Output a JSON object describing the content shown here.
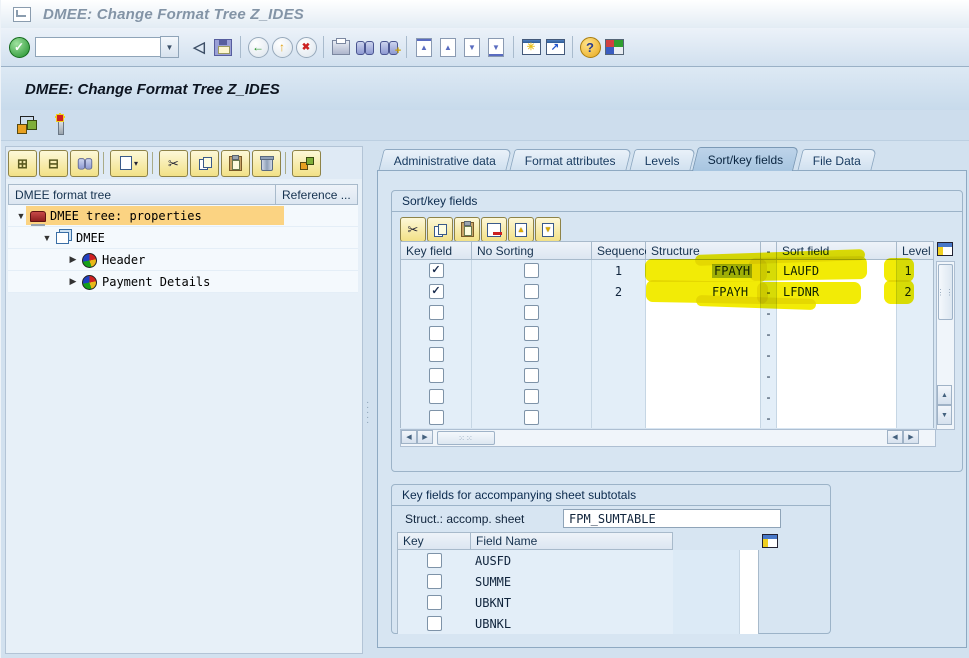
{
  "window": {
    "title": "DMEE: Change Format Tree Z_IDES"
  },
  "toolbar": {
    "command_value": "",
    "icons": [
      "enter-icon",
      "command-field",
      "enter-left-icon",
      "save-icon",
      "back-icon",
      "exit-icon",
      "cancel-icon",
      "print-icon",
      "find-icon",
      "find-next-icon",
      "first-page-icon",
      "page-up-icon",
      "page-down-icon",
      "last-page-icon",
      "new-session-icon",
      "create-shortcut-icon",
      "help-icon",
      "customize-layout-icon"
    ]
  },
  "glyphs": {
    "check": "✓",
    "enter_left": "◁",
    "back": "←",
    "exit": "↑",
    "cancel": "✖",
    "drop": "▼",
    "up": "▲",
    "down": "▼",
    "left": "◀",
    "right": "▶",
    "star": "✳",
    "shortcut": "↗",
    "help": "?",
    "scissors": "✂",
    "expand": "⊞",
    "collapse": "⊟",
    "plus": "+",
    "caret": "▾",
    "tree_open": "▼",
    "tree_closed": "▶",
    "grip_v": "⋮⋮",
    "dots": "·····"
  },
  "screen": {
    "title": "DMEE: Change Format Tree Z_IDES"
  },
  "appbar": {
    "icons": [
      "display-change-icon",
      "activate-icon"
    ]
  },
  "left_panel": {
    "toolbar_icons": [
      "expand-all-icon",
      "collapse-all-icon",
      "find-icon",
      "create-node-icon",
      "cut-icon",
      "copy-icon",
      "paste-icon",
      "delete-icon",
      "swap-icon"
    ],
    "header": {
      "col1": "DMEE format tree",
      "col2": "Reference ..."
    },
    "tree": [
      {
        "label": "DMEE tree: properties",
        "icon": "tree-properties-icon",
        "state": "expanded",
        "selected": true
      },
      {
        "label": "DMEE",
        "icon": "pages-icon",
        "state": "expanded",
        "selected": false
      },
      {
        "label": "Header",
        "icon": "pie-icon",
        "state": "collapsed",
        "selected": false
      },
      {
        "label": "Payment Details",
        "icon": "pie-icon",
        "state": "collapsed",
        "selected": false
      }
    ]
  },
  "tabs": [
    {
      "label": "Administrative data",
      "active": false
    },
    {
      "label": "Format attributes",
      "active": false
    },
    {
      "label": "Levels",
      "active": false
    },
    {
      "label": "Sort/key fields",
      "active": true
    },
    {
      "label": "File Data",
      "active": false
    }
  ],
  "sort_key_fields": {
    "group_title": "Sort/key fields",
    "toolbar_icons": [
      "cut-icon",
      "copy-icon",
      "paste-icon",
      "delete-row-icon",
      "move-row-up-icon",
      "move-row-down-icon"
    ],
    "columns": [
      "Key field",
      "No Sorting",
      "Sequence",
      "Structure",
      "-",
      "Sort field",
      "Level"
    ],
    "rows": [
      {
        "key_field": true,
        "no_sorting": false,
        "sequence": "1",
        "structure": "FPAYH",
        "dash": "-",
        "sort_field": "LAUFD",
        "level": "1",
        "highlighted": true,
        "structure_selected": true
      },
      {
        "key_field": true,
        "no_sorting": false,
        "sequence": "2",
        "structure": "FPAYH",
        "dash": "-",
        "sort_field": "LFDNR",
        "level": "2",
        "highlighted": true,
        "structure_selected": false
      },
      {
        "key_field": false,
        "no_sorting": false,
        "sequence": "",
        "structure": "",
        "dash": "-",
        "sort_field": "",
        "level": "",
        "highlighted": false,
        "structure_selected": false
      },
      {
        "key_field": false,
        "no_sorting": false,
        "sequence": "",
        "structure": "",
        "dash": "-",
        "sort_field": "",
        "level": "",
        "highlighted": false,
        "structure_selected": false
      },
      {
        "key_field": false,
        "no_sorting": false,
        "sequence": "",
        "structure": "",
        "dash": "-",
        "sort_field": "",
        "level": "",
        "highlighted": false,
        "structure_selected": false
      },
      {
        "key_field": false,
        "no_sorting": false,
        "sequence": "",
        "structure": "",
        "dash": "-",
        "sort_field": "",
        "level": "",
        "highlighted": false,
        "structure_selected": false
      },
      {
        "key_field": false,
        "no_sorting": false,
        "sequence": "",
        "structure": "",
        "dash": "-",
        "sort_field": "",
        "level": "",
        "highlighted": false,
        "structure_selected": false
      },
      {
        "key_field": false,
        "no_sorting": false,
        "sequence": "",
        "structure": "",
        "dash": "-",
        "sort_field": "",
        "level": "",
        "highlighted": false,
        "structure_selected": false
      }
    ]
  },
  "subtotals": {
    "group_title": "Key fields for accompanying sheet subtotals",
    "struct_label": "Struct.: accomp. sheet",
    "struct_value": "FPM_SUMTABLE",
    "columns": [
      "Key",
      "Field Name"
    ],
    "rows": [
      {
        "key": false,
        "field_name": "AUSFD"
      },
      {
        "key": false,
        "field_name": "SUMME"
      },
      {
        "key": false,
        "field_name": "UBKNT"
      },
      {
        "key": false,
        "field_name": "UBNKL"
      }
    ]
  },
  "annotation": {
    "marker_color": "#f2eb06",
    "note": "freehand yellow highlighter over key field rows"
  }
}
